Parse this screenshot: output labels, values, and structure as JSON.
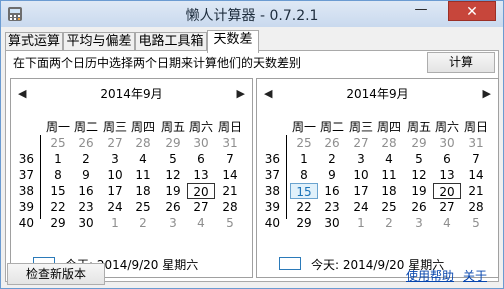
{
  "window": {
    "title": "懒人计算器 - 0.7.2.1",
    "minimize": "—",
    "close": "✕"
  },
  "tabs": [
    {
      "label": "算式运算"
    },
    {
      "label": "平均与偏差"
    },
    {
      "label": "电路工具箱"
    },
    {
      "label": "天数差"
    }
  ],
  "instruction": "在下面两个日历中选择两个日期来计算他们的天数差别",
  "calculate_label": "计算",
  "calendars": [
    {
      "month_label": "2014年9月",
      "weekdays": [
        "周一",
        "周二",
        "周三",
        "周四",
        "周五",
        "周六",
        "周日"
      ],
      "week_numbers": [
        "36",
        "37",
        "38",
        "39",
        "40"
      ],
      "days": [
        [
          "25",
          "26",
          "27",
          "28",
          "29",
          "30",
          "31"
        ],
        [
          "1",
          "2",
          "3",
          "4",
          "5",
          "6",
          "7"
        ],
        [
          "8",
          "9",
          "10",
          "11",
          "12",
          "13",
          "14"
        ],
        [
          "15",
          "16",
          "17",
          "18",
          "19",
          "20",
          "21"
        ],
        [
          "22",
          "23",
          "24",
          "25",
          "26",
          "27",
          "28"
        ],
        [
          "29",
          "30",
          "1",
          "2",
          "3",
          "4",
          "5"
        ]
      ],
      "today_text": "今天: 2014/9/20 星期六"
    },
    {
      "month_label": "2014年9月",
      "weekdays": [
        "周一",
        "周二",
        "周三",
        "周四",
        "周五",
        "周六",
        "周日"
      ],
      "week_numbers": [
        "36",
        "37",
        "38",
        "39",
        "40"
      ],
      "days": [
        [
          "25",
          "26",
          "27",
          "28",
          "29",
          "30",
          "31"
        ],
        [
          "1",
          "2",
          "3",
          "4",
          "5",
          "6",
          "7"
        ],
        [
          "8",
          "9",
          "10",
          "11",
          "12",
          "13",
          "14"
        ],
        [
          "15",
          "16",
          "17",
          "18",
          "19",
          "20",
          "21"
        ],
        [
          "22",
          "23",
          "24",
          "25",
          "26",
          "27",
          "28"
        ],
        [
          "29",
          "30",
          "1",
          "2",
          "3",
          "4",
          "5"
        ]
      ],
      "today_text": "今天: 2014/9/20 星期六"
    }
  ],
  "nav_prev": "◀",
  "nav_next": "▶",
  "check_update_label": "检查新版本",
  "help_link": "使用帮助",
  "about_link": "关于",
  "colors": {
    "accent": "#2b7ab9",
    "close": "#c7463b",
    "selected_fill": "#e1f1fb"
  }
}
